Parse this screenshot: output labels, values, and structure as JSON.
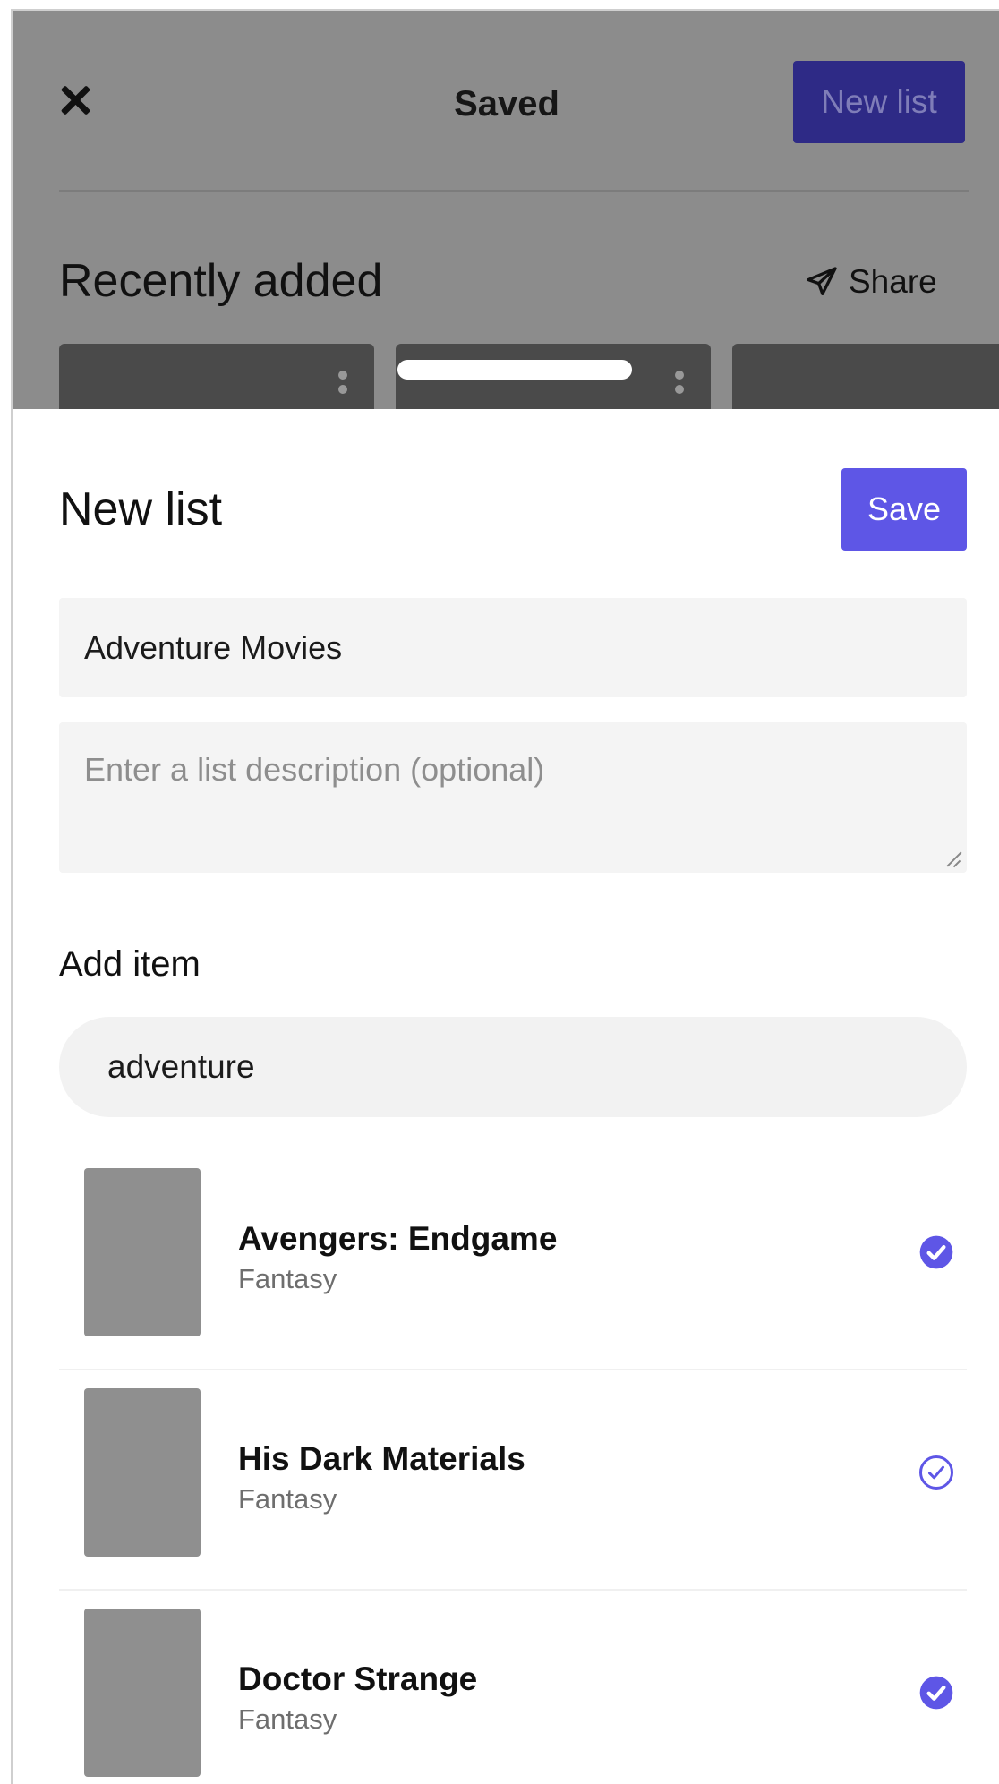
{
  "background": {
    "title": "Saved",
    "new_list_label": "New list",
    "section_title": "Recently added",
    "share_label": "Share"
  },
  "sheet": {
    "title": "New list",
    "save_label": "Save",
    "name_value": "Adventure Movies",
    "description_placeholder": "Enter a list description (optional)",
    "add_item_label": "Add item",
    "search_value": "adventure",
    "results": [
      {
        "title": "Avengers: Endgame",
        "genre": "Fantasy",
        "selected": true
      },
      {
        "title": "His Dark Materials",
        "genre": "Fantasy",
        "selected": false
      },
      {
        "title": "Doctor Strange",
        "genre": "Fantasy",
        "selected": true
      }
    ]
  },
  "colors": {
    "accent": "#5e56e6",
    "overlay_dim": "#8c8c8c"
  }
}
